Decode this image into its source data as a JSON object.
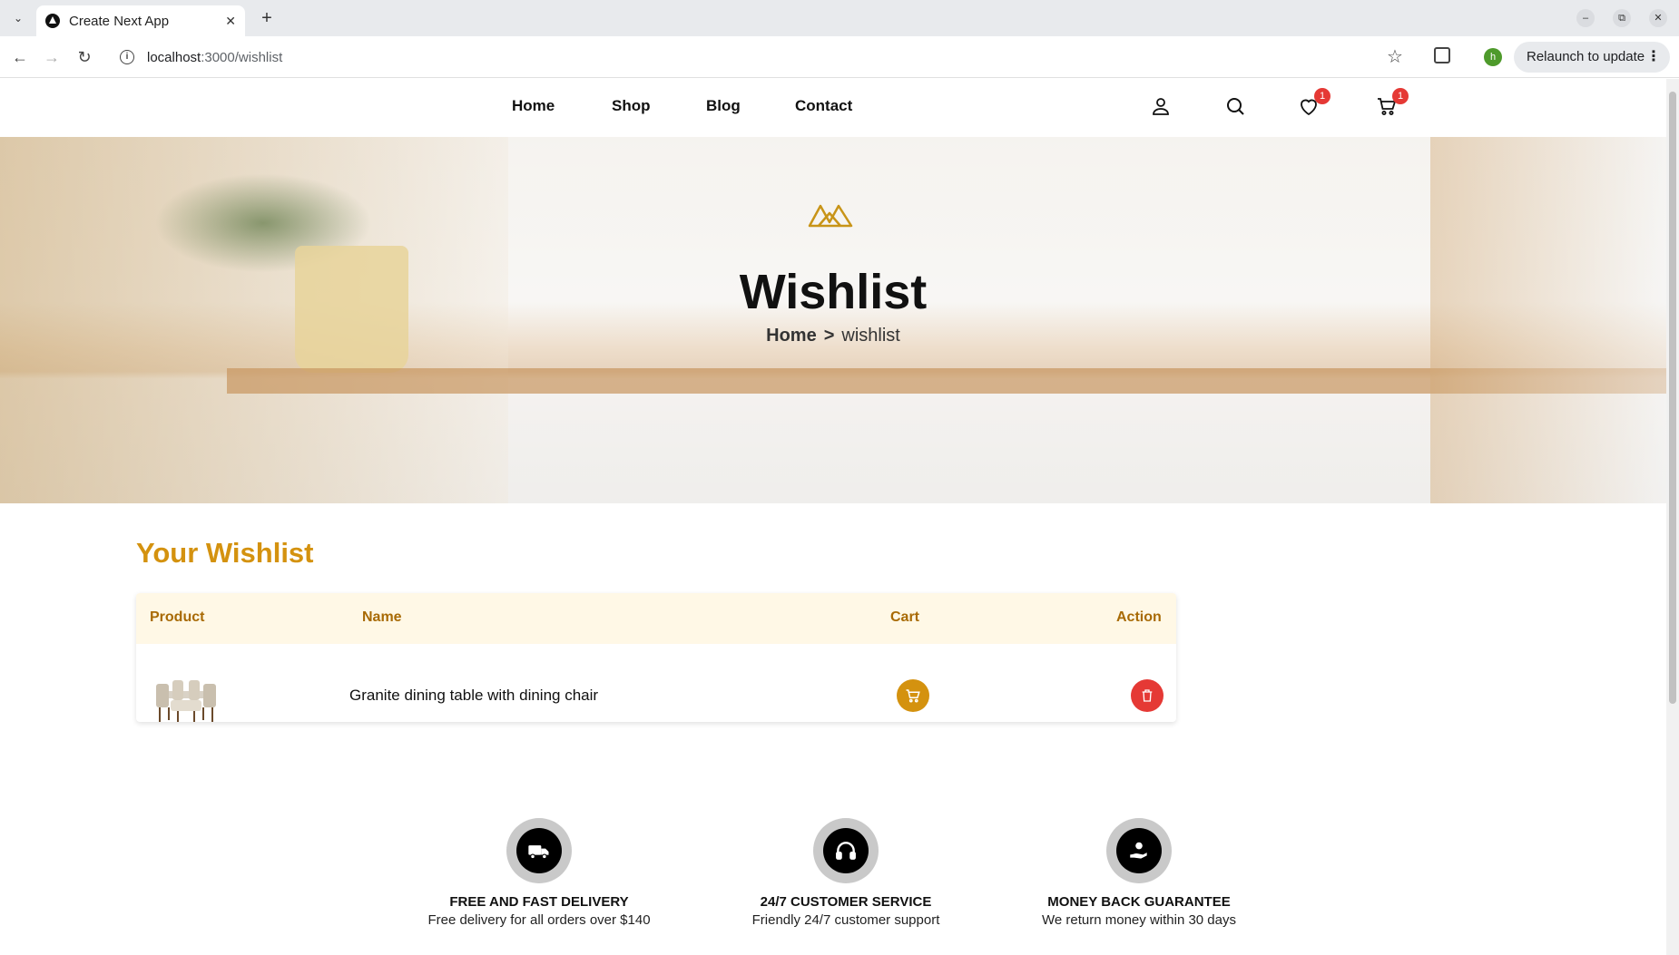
{
  "browser": {
    "tab_title": "Create Next App",
    "url_host": "localhost",
    "url_path": ":3000/wishlist",
    "profile_initial": "h",
    "relaunch_label": "Relaunch to update"
  },
  "nav": {
    "links": [
      "Home",
      "Shop",
      "Blog",
      "Contact"
    ],
    "wishlist_count": "1",
    "cart_count": "1"
  },
  "hero": {
    "title": "Wishlist",
    "breadcrumb_home": "Home",
    "breadcrumb_sep": ">",
    "breadcrumb_current": "wishlist"
  },
  "wishlist": {
    "heading": "Your Wishlist",
    "columns": [
      "Product",
      "Name",
      "Cart",
      "Action"
    ],
    "items": [
      {
        "name": "Granite dining table with dining chair"
      }
    ]
  },
  "features": [
    {
      "title": "FREE AND FAST DELIVERY",
      "desc": "Free delivery for all orders over $140",
      "icon": "truck-icon"
    },
    {
      "title": "24/7 CUSTOMER SERVICE",
      "desc": "Friendly 24/7 customer support",
      "icon": "headphones-icon"
    },
    {
      "title": "MONEY BACK GUARANTEE",
      "desc": "We return money within 30 days",
      "icon": "money-hand-icon"
    }
  ],
  "colors": {
    "accent": "#d4920f",
    "danger": "#e53935",
    "table_header_bg": "#fff8e6"
  }
}
